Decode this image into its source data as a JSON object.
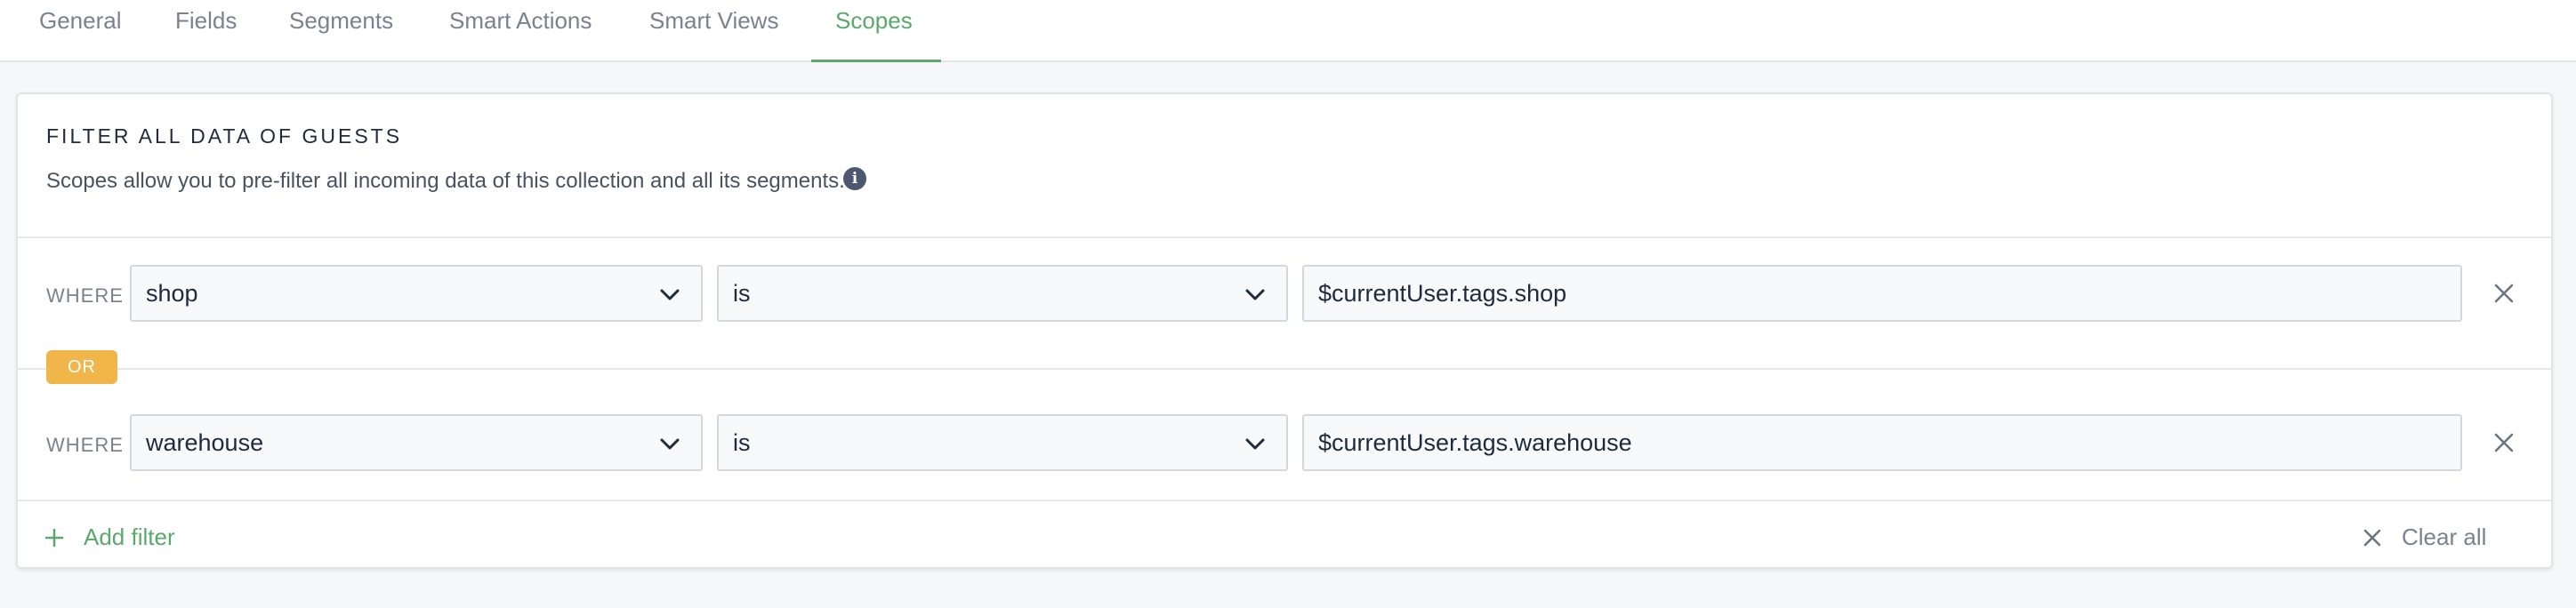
{
  "tabs": [
    {
      "label": "General"
    },
    {
      "label": "Fields"
    },
    {
      "label": "Segments"
    },
    {
      "label": "Smart Actions"
    },
    {
      "label": "Smart Views"
    },
    {
      "label": "Scopes",
      "active": true
    }
  ],
  "card": {
    "title": "FILTER ALL DATA OF GUESTS",
    "description": "Scopes allow you to pre-filter all incoming data of this collection and all its segments.",
    "info_icon": "i"
  },
  "filters": [
    {
      "where": "WHERE",
      "field": "shop",
      "operator": "is",
      "value": "$currentUser.tags.shop"
    },
    {
      "where": "WHERE",
      "field": "warehouse",
      "operator": "is",
      "value": "$currentUser.tags.warehouse"
    }
  ],
  "combinator": "OR",
  "footer": {
    "add_filter": "Add filter",
    "clear_all": "Clear all"
  },
  "colors": {
    "accent_green": "#5aa96b",
    "or_badge": "#f0b64a"
  }
}
